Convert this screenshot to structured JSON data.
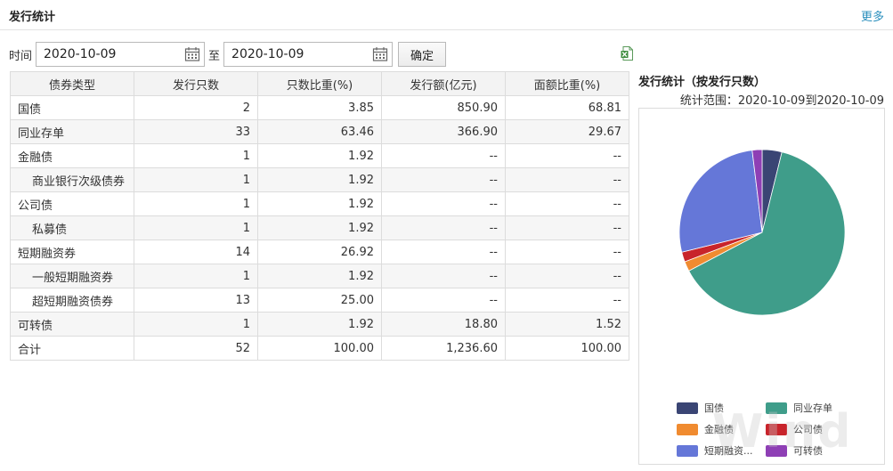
{
  "header": {
    "title": "发行统计",
    "more": "更多"
  },
  "filter": {
    "time_label": "时间",
    "start_date": "2020-10-09",
    "to_label": "至",
    "end_date": "2020-10-09",
    "confirm_label": "确定"
  },
  "table": {
    "columns": [
      "债券类型",
      "发行只数",
      "只数比重(%)",
      "发行额(亿元)",
      "面额比重(%)"
    ],
    "rows": [
      {
        "name": "国债",
        "sub": false,
        "count": "2",
        "count_pct": "3.85",
        "amount": "850.90",
        "amount_pct": "68.81"
      },
      {
        "name": "同业存单",
        "sub": false,
        "count": "33",
        "count_pct": "63.46",
        "amount": "366.90",
        "amount_pct": "29.67"
      },
      {
        "name": "金融债",
        "sub": false,
        "count": "1",
        "count_pct": "1.92",
        "amount": "--",
        "amount_pct": "--"
      },
      {
        "name": "商业银行次级债券",
        "sub": true,
        "count": "1",
        "count_pct": "1.92",
        "amount": "--",
        "amount_pct": "--"
      },
      {
        "name": "公司债",
        "sub": false,
        "count": "1",
        "count_pct": "1.92",
        "amount": "--",
        "amount_pct": "--"
      },
      {
        "name": "私募债",
        "sub": true,
        "count": "1",
        "count_pct": "1.92",
        "amount": "--",
        "amount_pct": "--"
      },
      {
        "name": "短期融资券",
        "sub": false,
        "count": "14",
        "count_pct": "26.92",
        "amount": "--",
        "amount_pct": "--"
      },
      {
        "name": "一般短期融资券",
        "sub": true,
        "count": "1",
        "count_pct": "1.92",
        "amount": "--",
        "amount_pct": "--"
      },
      {
        "name": "超短期融资债券",
        "sub": true,
        "count": "13",
        "count_pct": "25.00",
        "amount": "--",
        "amount_pct": "--"
      },
      {
        "name": "可转债",
        "sub": false,
        "count": "1",
        "count_pct": "1.92",
        "amount": "18.80",
        "amount_pct": "1.52"
      },
      {
        "name": "合计",
        "sub": false,
        "count": "52",
        "count_pct": "100.00",
        "amount": "1,236.60",
        "amount_pct": "100.00"
      }
    ]
  },
  "chart_data": {
    "type": "pie",
    "title": "发行统计（按发行只数）",
    "subtitle": "统计范围：2020-10-09到2020-10-09",
    "categories": [
      "国债",
      "同业存单",
      "金融债",
      "公司债",
      "短期融资...",
      "可转债"
    ],
    "values": [
      2,
      33,
      1,
      1,
      14,
      1
    ],
    "colors": [
      "#3a4574",
      "#3f9d8a",
      "#f08b30",
      "#c8242b",
      "#6577d8",
      "#8e3fb5"
    ],
    "legend": "bottom"
  },
  "watermark": "Wind"
}
